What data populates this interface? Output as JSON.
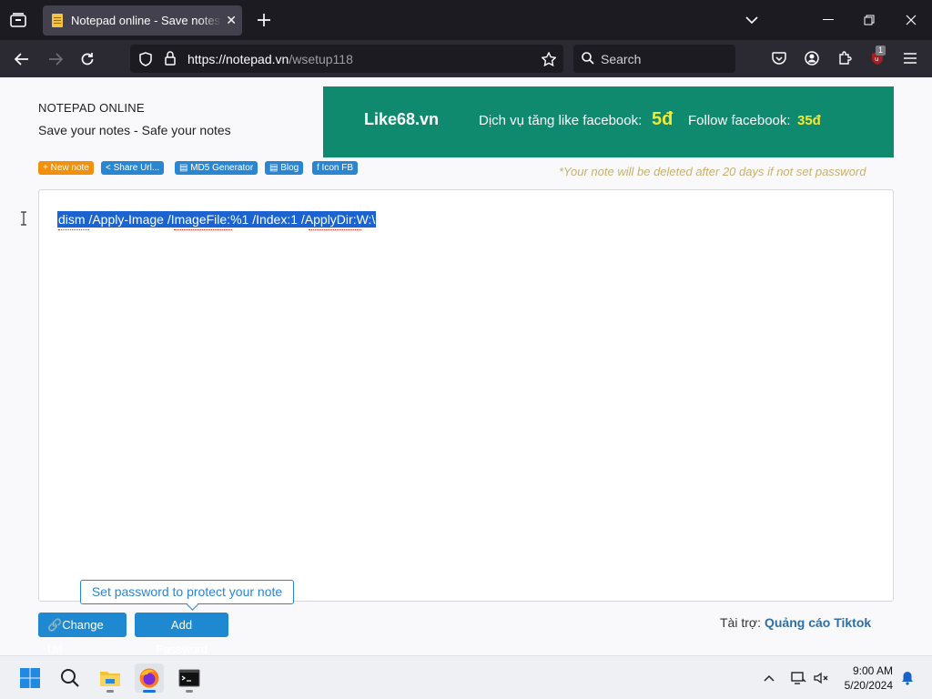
{
  "browser": {
    "tab_title": "Notepad online - Save notes online",
    "url_host": "https://notepad.vn",
    "url_path": "/wsetup118",
    "search_placeholder": "Search",
    "extension_badge": "1"
  },
  "site": {
    "title": "NOTEPAD ONLINE",
    "slogan": "Save your notes - Safe your notes"
  },
  "banner": {
    "brand": "Like68.vn",
    "service": "Dịch vụ tăng like facebook:",
    "price1": "5đ",
    "follow": "Follow facebook:",
    "price2": "35đ",
    "bg_color": "#0f8a6e"
  },
  "toolbar": {
    "new_note": "+ New note",
    "share_url": "< Share Url...",
    "md5": "▤ MD5 Generator",
    "blog": "▤ Blog",
    "icon_fb": "f Icon FB",
    "delete_notice": "*Your note will be deleted after 20 days if not set password"
  },
  "editor": {
    "content": "dism /Apply-Image /ImageFile:%1 /Index:1 /ApplyDir:W:\\"
  },
  "footer": {
    "tooltip": "Set password to protect your note",
    "change_url": "Change Url",
    "add_password": "Add Password",
    "sponsor_label": "Tài trợ:",
    "sponsor_link": "Quảng cáo Tiktok"
  },
  "taskbar": {
    "time": "9:00 AM",
    "date": "5/20/2024"
  }
}
